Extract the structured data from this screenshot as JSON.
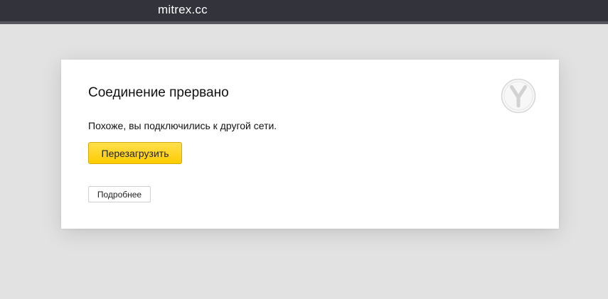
{
  "header": {
    "site_title": "mitrex.cc"
  },
  "error_card": {
    "title": "Соединение прервано",
    "message": "Похоже, вы подключились к другой сети.",
    "reload_label": "Перезагрузить",
    "details_label": "Подробнее",
    "logo_icon": "yandex-browser-logo-icon"
  },
  "colors": {
    "topbar": "#33333b",
    "background": "#e2e2e2",
    "reload_button": "#ffcc00"
  }
}
